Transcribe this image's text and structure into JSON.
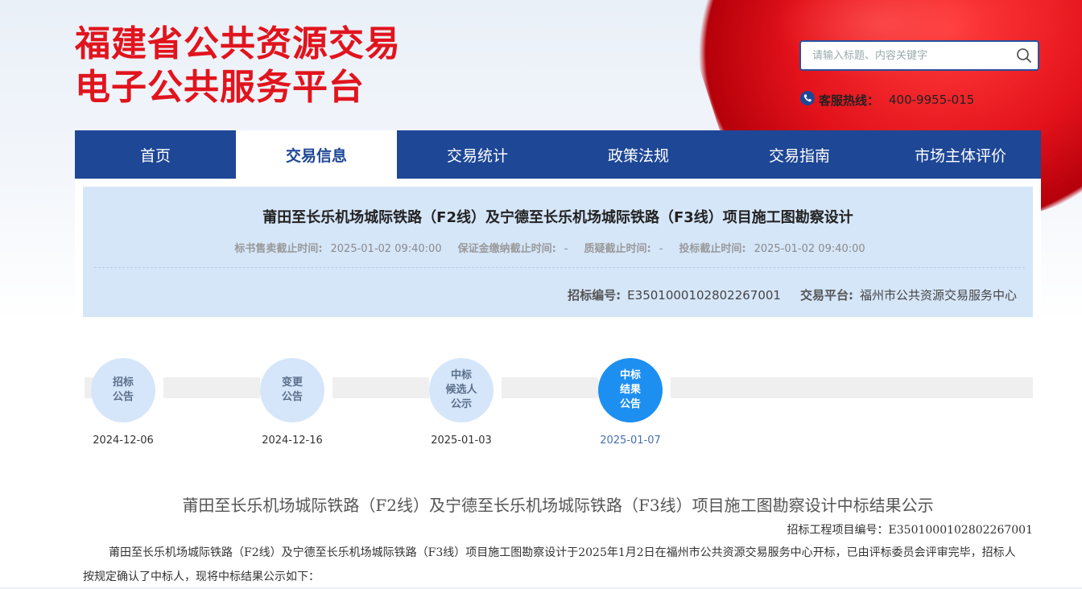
{
  "header": {
    "logo_line1": "福建省公共资源交易",
    "logo_line2": "电子公共服务平台",
    "search_placeholder": "请输入标题、内容关键字",
    "hotline_label": "客服热线：",
    "hotline_number": "400-9955-015"
  },
  "nav": {
    "items": [
      "首页",
      "交易信息",
      "交易统计",
      "政策法规",
      "交易指南",
      "市场主体评价"
    ],
    "active_index": 1
  },
  "project": {
    "title": "莆田至长乐机场城际铁路（F2线）及宁德至长乐机场城际铁路（F3线）项目施工图勘察设计",
    "times": [
      {
        "label": "标书售卖截止时间:",
        "value": "2025-01-02 09:40:00"
      },
      {
        "label": "保证金缴纳截止时间:",
        "value": "-"
      },
      {
        "label": "质疑截止时间:",
        "value": "-"
      },
      {
        "label": "投标截止时间:",
        "value": "2025-01-02 09:40:00"
      }
    ],
    "code_label": "招标编号:",
    "code_value": "E3501000102802267001",
    "platform_label": "交易平台:",
    "platform_value": "福州市公共资源交易服务中心"
  },
  "timeline": {
    "steps": [
      {
        "label_lines": [
          "招标",
          "公告"
        ],
        "date": "2024-12-06"
      },
      {
        "label_lines": [
          "变更",
          "公告"
        ],
        "date": "2024-12-16"
      },
      {
        "label_lines": [
          "中标",
          "候选人",
          "公示"
        ],
        "date": "2025-01-03"
      },
      {
        "label_lines": [
          "中标",
          "结果",
          "公告"
        ],
        "date": "2025-01-07"
      }
    ],
    "active_index": 3
  },
  "document": {
    "title": "莆田至长乐机场城际铁路（F2线）及宁德至长乐机场城际铁路（F3线）项目施工图勘察设计中标结果公示",
    "code_line": "招标工程项目编号：E3501000102802267001",
    "paragraph": "莆田至长乐机场城际铁路（F2线）及宁德至长乐机场城际铁路（F3线）项目施工图勘察设计于2025年1月2日在福州市公共资源交易服务中心开标，已由评标委员会评审完毕，招标人按规定确认了中标人，现将中标结果公示如下："
  }
}
